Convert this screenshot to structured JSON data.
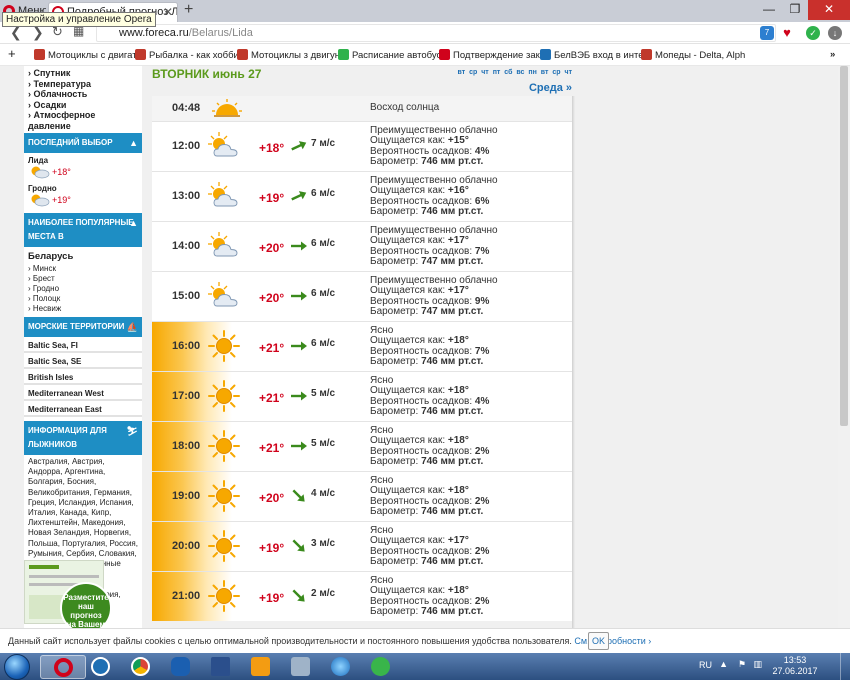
{
  "browser": {
    "menu_label": "Меню",
    "tab_title": "Подробный прогноз Лид",
    "tooltip": "Настройка и управление Opera",
    "url_host": "www.foreca.ru",
    "url_path": "/Belarus/Lida",
    "badge_count": "7",
    "bookmarks": [
      "Мотоциклы с двигат",
      "Рыбалка - как хобби",
      "Мотоциклы з двигун",
      "Расписание автобус",
      "Подтверждение зак",
      "БелВЭБ вход в инте",
      "Мопеды - Delta, Alph"
    ]
  },
  "sidebar": {
    "links": [
      "Спутник",
      "Температура",
      "Облачность",
      "Осадки",
      "Атмосферное давление"
    ],
    "last_choice_title": "ПОСЛЕДНИЙ ВЫБОР",
    "last_choice": [
      {
        "city": "Лида",
        "temp": "+18°"
      },
      {
        "city": "Гродно",
        "temp": "+19°"
      }
    ],
    "popular_title_1": "НАИБОЛЕЕ ПОПУЛЯРНЫЕ",
    "popular_title_2": "МЕСТА В",
    "country": "Беларусь",
    "popular_cities": [
      "Минск",
      "Брест",
      "Гродно",
      "Полоцк",
      "Несвиж"
    ],
    "sea_title": "МОРСКИЕ ТЕРРИТОРИИ",
    "sea_items": [
      "Baltic Sea, FI",
      "Baltic Sea, SE",
      "British Isles",
      "Mediterranean West",
      "Mediterranean East"
    ],
    "ski_title_1": "ИНФОРМАЦИЯ ДЛЯ",
    "ski_title_2": "ЛЫЖНИКОВ",
    "ski_text": "Австралия, Австрия, Андорра, Аргентина, Болгария, Босния, Великобритания, Германия, Греция, Исландия, Испания, Италия, Канада, Кипр, Лихтенштейн, Македония, Новая Зеландия, Норвегия, Польша, Португалия, Россия, Румыния, Сербия, Словакия, Словения, Соединенные Штаты, Финляндия, Франция, Чешская Республика, Швейцария, Швеция",
    "promo_text_1": "Разместите",
    "promo_text_2": "наш прогноз",
    "promo_text_3": "на Вашем"
  },
  "main": {
    "day_title": "ВТОРНИК июнь 27",
    "day_nav": [
      "вт",
      "ср",
      "чт",
      "пт",
      "сб",
      "вс",
      "пн",
      "вт",
      "ср",
      "чт"
    ],
    "next_day": "Среда »",
    "sunrise": {
      "time": "04:48",
      "label": "Восход солнца"
    },
    "feels_label": "Ощущается как:",
    "precip_label": "Вероятность осадков:",
    "baro_label": "Барометр:",
    "rows": [
      {
        "time": "12:00",
        "icon": "partly-cloudy",
        "temp": "+18°",
        "wind_dir": "ne",
        "wind": "7 м/с",
        "desc": "Преимущественно облачно",
        "feels": "+15°",
        "precip": "4%",
        "baro": "746 мм рт.ст."
      },
      {
        "time": "13:00",
        "icon": "partly-cloudy",
        "temp": "+19°",
        "wind_dir": "ne",
        "wind": "6 м/с",
        "desc": "Преимущественно облачно",
        "feels": "+16°",
        "precip": "6%",
        "baro": "746 мм рт.ст."
      },
      {
        "time": "14:00",
        "icon": "partly-cloudy",
        "temp": "+20°",
        "wind_dir": "e",
        "wind": "6 м/с",
        "desc": "Преимущественно облачно",
        "feels": "+17°",
        "precip": "7%",
        "baro": "747 мм рт.ст."
      },
      {
        "time": "15:00",
        "icon": "partly-cloudy",
        "temp": "+20°",
        "wind_dir": "e",
        "wind": "6 м/с",
        "desc": "Преимущественно облачно",
        "feels": "+17°",
        "precip": "9%",
        "baro": "747 мм рт.ст."
      },
      {
        "time": "16:00",
        "icon": "sun",
        "temp": "+21°",
        "wind_dir": "e",
        "wind": "6 м/с",
        "desc": "Ясно",
        "feels": "+18°",
        "precip": "7%",
        "baro": "746 мм рт.ст."
      },
      {
        "time": "17:00",
        "icon": "sun",
        "temp": "+21°",
        "wind_dir": "e",
        "wind": "5 м/с",
        "desc": "Ясно",
        "feels": "+18°",
        "precip": "4%",
        "baro": "746 мм рт.ст."
      },
      {
        "time": "18:00",
        "icon": "sun",
        "temp": "+21°",
        "wind_dir": "e",
        "wind": "5 м/с",
        "desc": "Ясно",
        "feels": "+18°",
        "precip": "2%",
        "baro": "746 мм рт.ст."
      },
      {
        "time": "19:00",
        "icon": "sun",
        "temp": "+20°",
        "wind_dir": "se",
        "wind": "4 м/с",
        "desc": "Ясно",
        "feels": "+18°",
        "precip": "2%",
        "baro": "746 мм рт.ст."
      },
      {
        "time": "20:00",
        "icon": "sun",
        "temp": "+19°",
        "wind_dir": "se",
        "wind": "3 м/с",
        "desc": "Ясно",
        "feels": "+17°",
        "precip": "2%",
        "baro": "746 мм рт.ст."
      },
      {
        "time": "21:00",
        "icon": "sun",
        "temp": "+19°",
        "wind_dir": "se",
        "wind": "2 м/с",
        "desc": "Ясно",
        "feels": "+18°",
        "precip": "2%",
        "baro": "746 мм рт.ст."
      }
    ]
  },
  "cookie": {
    "text": "Данный сайт использует файлы cookies с целью оптимальной производительности и постоянного повышения удобства пользователя.",
    "link": "См. подробности ›",
    "ok": "OK"
  },
  "taskbar": {
    "lang": "RU",
    "time": "13:53",
    "date": "27.06.2017"
  },
  "colors": {
    "accent_blue": "#1e8ec4",
    "title_green": "#5b9a1c",
    "temp_red": "#d0021b",
    "sunny_orange": "#f7a800"
  }
}
